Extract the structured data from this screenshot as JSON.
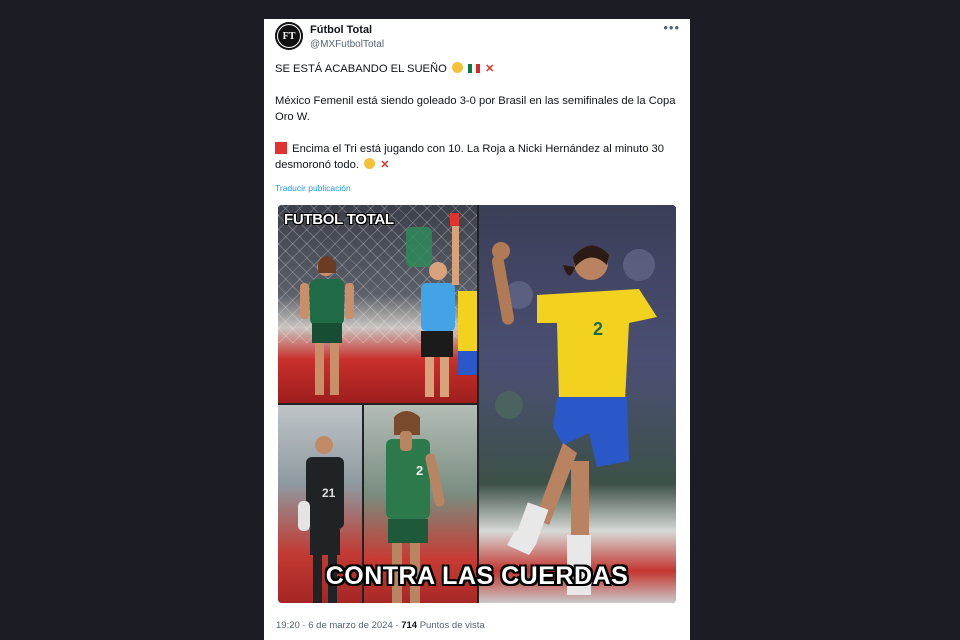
{
  "account": {
    "display_name": "Fútbol Total",
    "handle": "@MXFutbolTotal",
    "avatar_text": "FT"
  },
  "post": {
    "line1": "SE ESTÁ ACABANDO EL SUEÑO",
    "para2": "México Femenil está siendo goleado 3-0 por Brasil en las semifinales de la Copa Oro W.",
    "para3": "Encima el Tri está jugando con 10. La Roja a Nicki Hernández al minuto 30 desmoronó todo.",
    "translate_link": "Traducir publicación",
    "x_mark": "✕"
  },
  "media": {
    "logo_text": "FUTBOL TOTAL",
    "caption": "CONTRA LAS CUERDAS",
    "jersey_numbers": [
      "2",
      "2",
      "21"
    ]
  },
  "meta": {
    "time": "19:20",
    "separator": "·",
    "date": "6 de marzo de 2024",
    "views_count": "714",
    "views_label": "Puntos de vista"
  },
  "icons": {
    "more": "more-options-icon",
    "sad": "sad-emoji-icon",
    "flag": "mexico-flag-icon",
    "cross": "red-cross-icon",
    "red_card": "red-card-icon"
  },
  "colors": {
    "background": "#1c1d24",
    "link": "#1d9bf0",
    "mexico_green": "#1f6b45",
    "brazil_yellow": "#f2d21f",
    "brazil_blue": "#2a58c9",
    "red": "#e0322f"
  }
}
